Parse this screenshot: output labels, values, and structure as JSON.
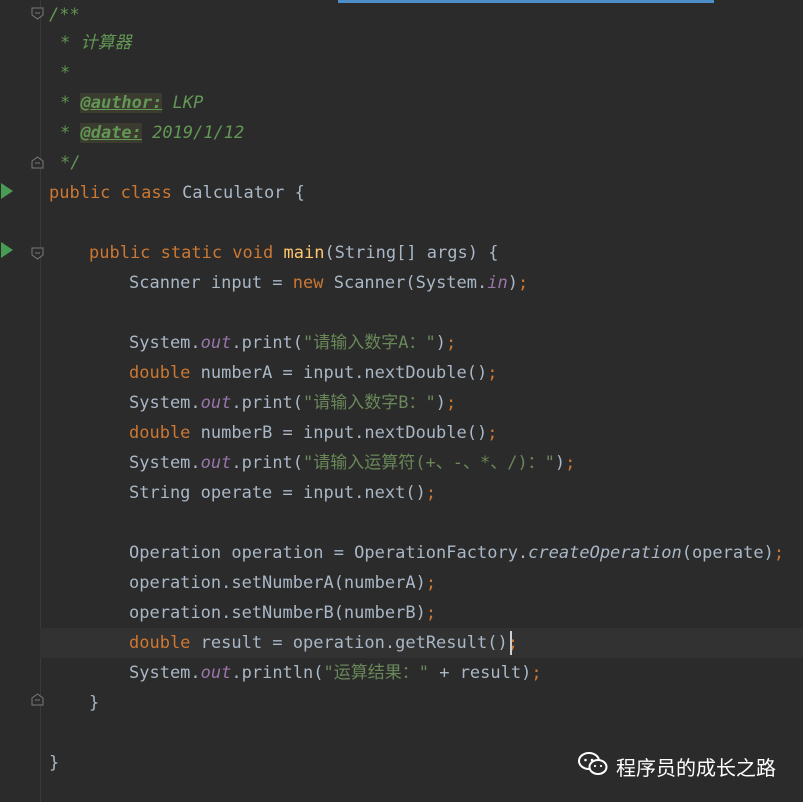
{
  "code": {
    "l1": "/**",
    "l2": "* 计算器",
    "l3": "*",
    "l4_star": "* ",
    "l4_tag": "@author:",
    "l4_val": " LKP",
    "l5_star": "* ",
    "l5_tag": "@date:",
    "l5_val": " 2019/1/12",
    "l6": "*/",
    "l7_kw": "public class",
    "l7_name": " Calculator {",
    "l9_kw": "public static void",
    "l9_fn": "main",
    "l9_rest": "(String[] args) {",
    "l10_a": "Scanner input = ",
    "l10_kw": "new",
    "l10_b": " Scanner(System.",
    "l10_f": "in",
    "l10_c": ")",
    "semi": ";",
    "sys": "System.",
    "out": "out",
    "print": ".print(",
    "println": ".println(",
    "l12_str": "\"请输入数字A：\"",
    "close": ")",
    "double": "double",
    "l13_rest": " numberA = input.nextDouble()",
    "l14_str": "\"请输入数字B：\"",
    "l15_rest": " numberB = input.nextDouble()",
    "l16_str": "\"请输入运算符(+、-、*、/)：\"",
    "l17": "String operate = input.next()",
    "l19_a": "Operation operation = OperationFactory.",
    "l19_m": "createOperation",
    "l19_b": "(operate)",
    "l20": "operation.setNumberA(numberA)",
    "l21": "operation.setNumberB(numberB)",
    "l22_rest": " result = operation.getResult()",
    "l23_str": "\"运算结果：\"",
    "l23_rest": " + result)",
    "l24": "}",
    "l26": "}"
  },
  "watermark": {
    "text": "程序员的成长之路"
  },
  "colors": {
    "background": "#2b2b2b",
    "keyword": "#cc7832",
    "string": "#6a8759",
    "doc": "#629755",
    "field": "#9876aa",
    "function": "#ffc66d"
  }
}
